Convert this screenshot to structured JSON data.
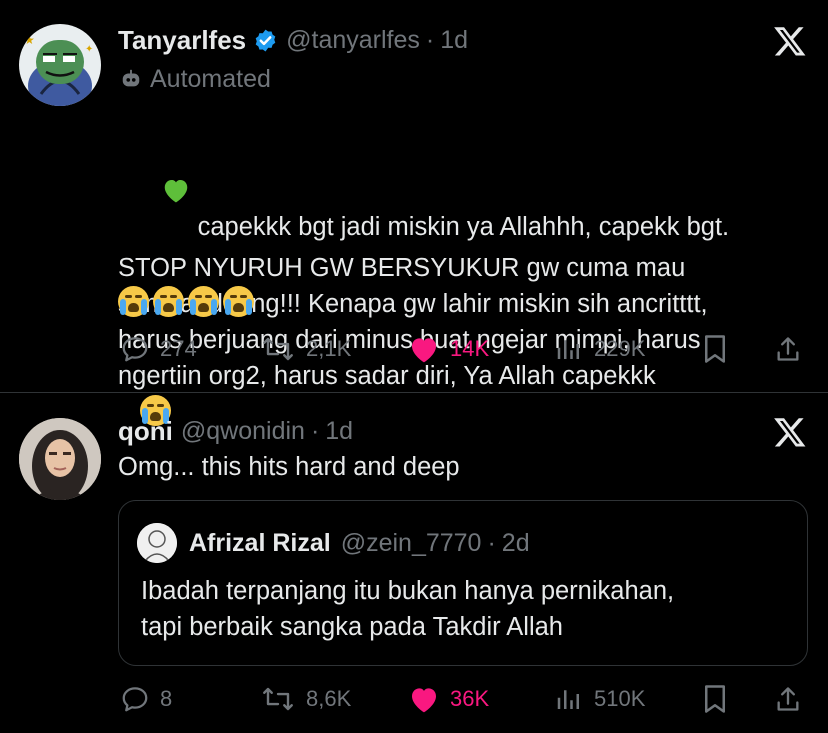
{
  "tweet1": {
    "display_name": "Tanyarlfes",
    "handle": "@tanyarlfes",
    "time": "1d",
    "label": "Automated",
    "text": " capekkk bgt jadi miskin ya Allahhh, capekk bgt.\nSTOP NYURUH GW BERSYUKUR gw cuma mau\nsambat doang!!! Kenapa gw lahir miskin sih ancritttt,\nharus berjuang dari minus buat ngejar mimpi, harus\nngertiin org2, harus sadar diri, Ya Allah capekkk",
    "actions": {
      "replies": "274",
      "reposts": "2,1K",
      "likes": "14K",
      "views": "229K"
    },
    "icons": [
      "green-heart-icon",
      "verified-badge-icon",
      "robot-icon",
      "crying-face-icon",
      "x-logo-icon"
    ]
  },
  "tweet2": {
    "display_name": "qoni",
    "handle": "@qwonidin",
    "time": "1d",
    "text": "Omg... this hits hard and deep",
    "quote": {
      "display_name": "Afrizal Rizal",
      "handle": "@zein_7770",
      "time": "2d",
      "text": "Ibadah terpanjang itu bukan hanya pernikahan,\ntapi berbaik sangka pada Takdir Allah"
    },
    "actions": {
      "replies": "8",
      "reposts": "8,6K",
      "likes": "36K",
      "views": "510K"
    }
  },
  "colors": {
    "background": "#000000",
    "text": "#e7e9ea",
    "muted": "#71767b",
    "like": "#f91880",
    "verified": "#1d9bf0",
    "divider": "#2f3336"
  }
}
